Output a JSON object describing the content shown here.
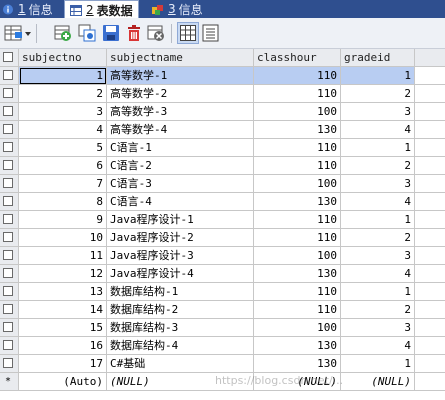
{
  "tabs": [
    {
      "num": "1",
      "label": "信息",
      "active": false
    },
    {
      "num": "2",
      "label": "表数据",
      "active": true
    },
    {
      "num": "3",
      "label": "信息",
      "active": false
    }
  ],
  "columns": [
    "subjectno",
    "subjectname",
    "classhour",
    "gradeid"
  ],
  "rows": [
    [
      "1",
      "高等数学-1",
      "110",
      "1"
    ],
    [
      "2",
      "高等数学-2",
      "110",
      "2"
    ],
    [
      "3",
      "高等数学-3",
      "100",
      "3"
    ],
    [
      "4",
      "高等数学-4",
      "130",
      "4"
    ],
    [
      "5",
      "C语言-1",
      "110",
      "1"
    ],
    [
      "6",
      "C语言-2",
      "110",
      "2"
    ],
    [
      "7",
      "C语言-3",
      "100",
      "3"
    ],
    [
      "8",
      "C语言-4",
      "130",
      "4"
    ],
    [
      "9",
      "Java程序设计-1",
      "110",
      "1"
    ],
    [
      "10",
      "Java程序设计-2",
      "110",
      "2"
    ],
    [
      "11",
      "Java程序设计-3",
      "100",
      "3"
    ],
    [
      "12",
      "Java程序设计-4",
      "130",
      "4"
    ],
    [
      "13",
      "数据库结构-1",
      "110",
      "1"
    ],
    [
      "14",
      "数据库结构-2",
      "110",
      "2"
    ],
    [
      "15",
      "数据库结构-3",
      "100",
      "3"
    ],
    [
      "16",
      "数据库结构-4",
      "130",
      "4"
    ],
    [
      "17",
      "C#基础",
      "130",
      "1"
    ]
  ],
  "new_row": {
    "marker": "*",
    "values": [
      "(Auto)",
      "(NULL)",
      "(NULL)",
      "(NULL)"
    ]
  },
  "watermark": "https://blog.csdn.net/..."
}
